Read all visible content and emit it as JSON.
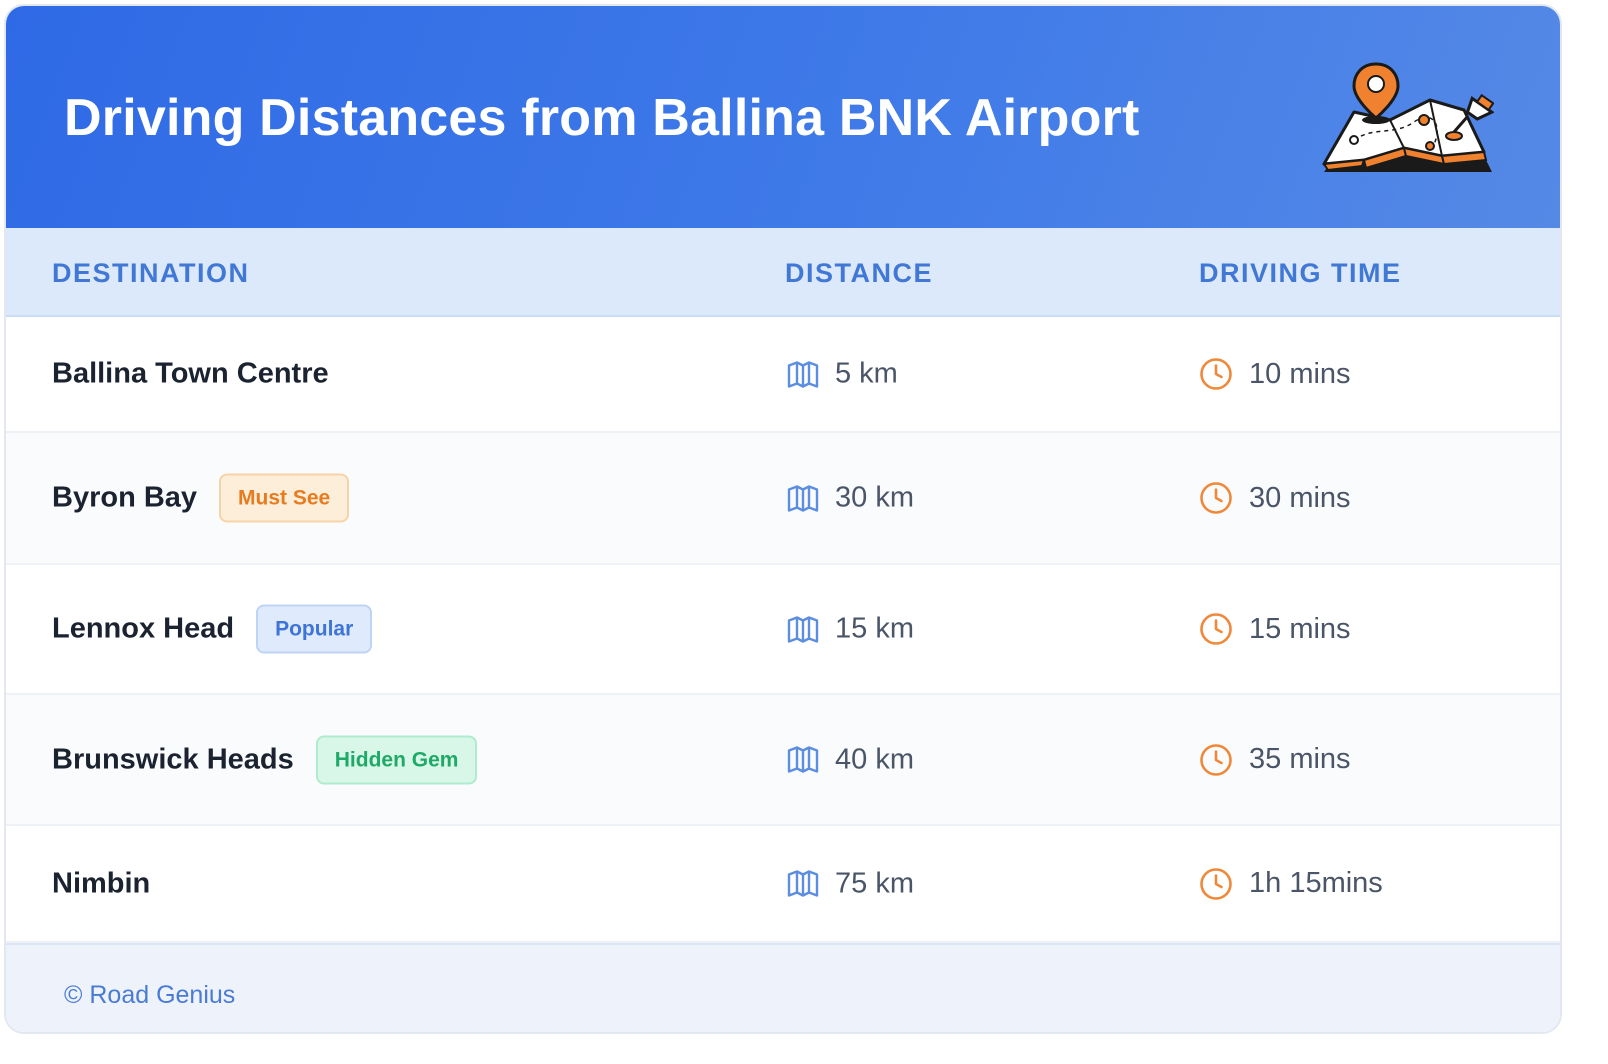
{
  "header": {
    "title": "Driving Distances from Ballina BNK Airport",
    "illustration": "map-with-pins-icon"
  },
  "table": {
    "columns": [
      "DESTINATION",
      "DISTANCE",
      "DRIVING TIME"
    ],
    "rows": [
      {
        "destination": "Ballina Town Centre",
        "badge": "",
        "badge_style": "",
        "distance": "5 km",
        "time": "10 mins"
      },
      {
        "destination": "Byron Bay",
        "badge": "Must See",
        "badge_style": "orange",
        "distance": "30 km",
        "time": "30 mins"
      },
      {
        "destination": "Lennox Head",
        "badge": "Popular",
        "badge_style": "blue",
        "distance": "15 km",
        "time": "15 mins"
      },
      {
        "destination": "Brunswick Heads",
        "badge": "Hidden Gem",
        "badge_style": "green",
        "distance": "40 km",
        "time": "35 mins"
      },
      {
        "destination": "Nimbin",
        "badge": "",
        "badge_style": "",
        "distance": "75 km",
        "time": "1h 15mins"
      }
    ],
    "distance_icon": "map-icon",
    "time_icon": "clock-icon"
  },
  "footer": {
    "text": "© Road Genius"
  },
  "colors": {
    "header_start": "#2f6ae6",
    "header_end": "#5589e6",
    "column_header_text": "#4178d6",
    "map_icon": "#5b8de0",
    "clock_icon": "#f0883a"
  }
}
